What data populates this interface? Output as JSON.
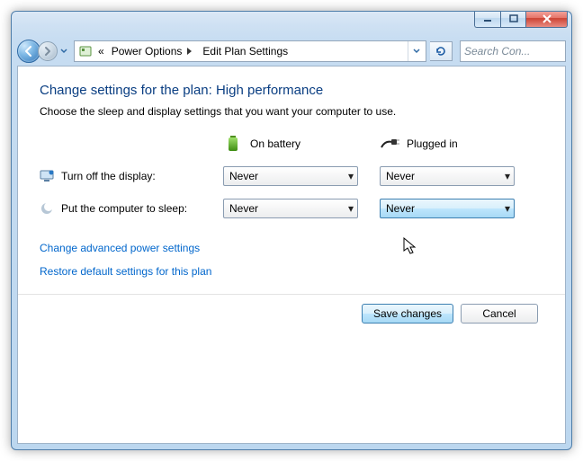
{
  "titlebar": {
    "min_tooltip": "Minimize",
    "max_tooltip": "Maximize",
    "close_tooltip": "Close"
  },
  "nav": {
    "breadcrumb_prefix": "«",
    "crumb1": "Power Options",
    "crumb2": "Edit Plan Settings"
  },
  "search": {
    "placeholder": "Search Con..."
  },
  "page": {
    "title": "Change settings for the plan: High performance",
    "subtitle": "Choose the sleep and display settings that you want your computer to use."
  },
  "columns": {
    "battery": "On battery",
    "plugged": "Plugged in"
  },
  "rows": {
    "display": {
      "label": "Turn off the display:",
      "battery": "Never",
      "plugged": "Never"
    },
    "sleep": {
      "label": "Put the computer to sleep:",
      "battery": "Never",
      "plugged": "Never"
    }
  },
  "links": {
    "advanced": "Change advanced power settings",
    "restore": "Restore default settings for this plan"
  },
  "buttons": {
    "save": "Save changes",
    "cancel": "Cancel"
  }
}
